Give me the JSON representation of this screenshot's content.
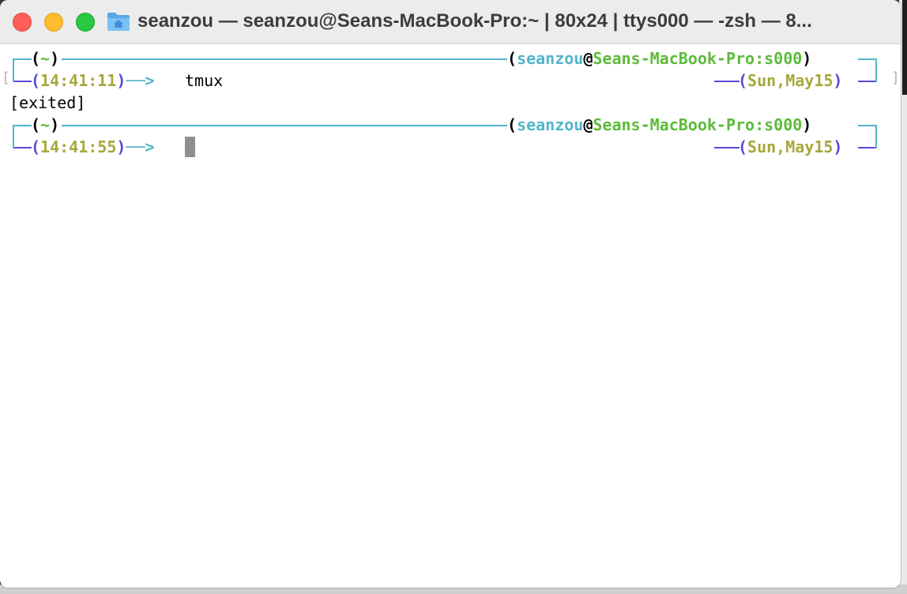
{
  "window": {
    "title": "seanzou — seanzou@Seans-MacBook-Pro:~ | 80x24 | ttys000 — -zsh — 8..."
  },
  "icons": {
    "close": "close-icon",
    "minimize": "minimize-icon",
    "maximize": "maximize-icon",
    "folder": "home-folder-icon"
  },
  "colors": {
    "frame": "#52b4c8",
    "user": "#52b4c8",
    "host": "#5dbb3a",
    "time": "#a7a73c",
    "bracket": "#5a48d6"
  },
  "prompt1": {
    "cwd": "~",
    "user": "seanzou",
    "at": "@",
    "host": "Seans-MacBook-Pro:s000",
    "time": "14:41:11",
    "arrow": "──>",
    "command": "tmux",
    "date": "Sun,May15"
  },
  "output": {
    "line1": "[exited]"
  },
  "prompt2": {
    "cwd": "~",
    "user": "seanzou",
    "at": "@",
    "host": "Seans-MacBook-Pro:s000",
    "time": "14:41:55",
    "arrow": "──>",
    "date": "Sun,May15"
  }
}
